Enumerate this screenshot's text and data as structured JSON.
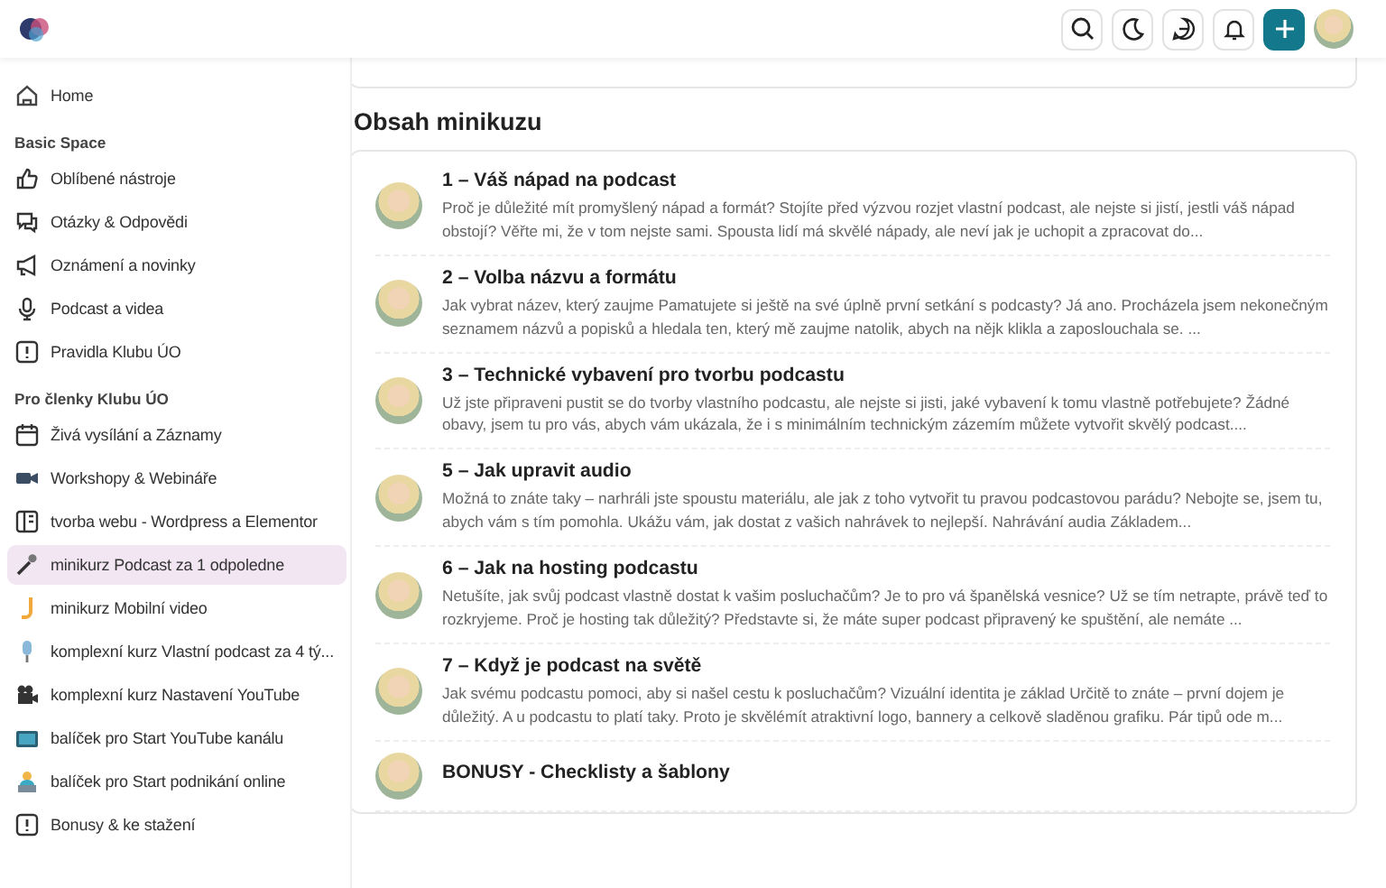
{
  "sidebar": {
    "home": {
      "label": "Home",
      "selected": false
    },
    "sections": [
      {
        "title": "Basic Space",
        "items": [
          {
            "label": "Oblíbené nástroje",
            "selected": false
          },
          {
            "label": "Otázky & Odpovědi",
            "selected": false
          },
          {
            "label": "Oznámení a novinky",
            "selected": false
          },
          {
            "label": "Podcast a videa",
            "selected": false
          },
          {
            "label": "Pravidla Klubu ÚO",
            "selected": false
          }
        ]
      },
      {
        "title": "Pro členky Klubu ÚO",
        "items": [
          {
            "label": "Živá vysílání a Záznamy",
            "selected": false
          },
          {
            "label": "Workshopy & Webináře",
            "selected": false
          },
          {
            "label": "tvorba webu - Wordpress a Elementor",
            "selected": false
          },
          {
            "label": "minikurz Podcast za 1 odpoledne",
            "selected": true
          },
          {
            "label": "minikurz Mobilní video",
            "selected": false
          },
          {
            "label": "komplexní kurz Vlastní podcast za 4 tý...",
            "selected": false
          },
          {
            "label": "komplexní kurz Nastavení YouTube",
            "selected": false
          },
          {
            "label": "balíček pro Start YouTube kanálu",
            "selected": false
          },
          {
            "label": "balíček pro Start podnikání online",
            "selected": false
          },
          {
            "label": "Bonusy & ke stažení",
            "selected": false
          }
        ]
      }
    ]
  },
  "main": {
    "heading": "Obsah minikuzu",
    "lessons": [
      {
        "title": "1 – Váš nápad na podcast",
        "text": "Proč je důležité mít promyšlený nápad a formát? Stojíte před výzvou rozjet vlastní podcast, ale nejste si jistí, jestli váš nápad obstojí? Věřte mi, že v tom nejste sami. Spousta lidí má skvělé nápady, ale neví jak je uchopit a zpracovat do..."
      },
      {
        "title": "2 – Volba názvu a formátu",
        "text": "Jak vybrat název, který zaujme Pamatujete si ještě na své úplně první setkání s podcasty? Já ano. Procházela jsem nekonečným seznamem názvů a popisků a hledala ten, který mě zaujme natolik, abych na nějk klikla a zaposlouchala se. ..."
      },
      {
        "title": "3 – Technické vybavení pro tvorbu podcastu",
        "text": "Už jste připraveni pustit se do tvorby vlastního podcastu, ale nejste si jisti, jaké vybavení k tomu vlastně potřebujete? Žádné obavy, jsem tu pro vás, abych vám ukázala, že i s minimálním technickým zázemím můžete vytvořit skvělý podcast...."
      },
      {
        "title": "5 – Jak upravit audio",
        "text": "Možná to znáte taky – narhráli jste spoustu materiálu, ale jak z toho vytvořit tu pravou podcastovou parádu? Nebojte se, jsem tu, abych vám s tím pomohla. Ukážu vám, jak dostat z vašich nahrávek to nejlepší. Nahrávání audia Základem..."
      },
      {
        "title": "6 – Jak na hosting podcastu",
        "text": "Netušíte, jak svůj podcast vlastně dostat k vašim posluchačům? Je to pro vá španělská vesnice? Už se tím netrapte, právě teď to rozkryjeme. Proč je hosting tak důležitý? Představte si, že máte super podcast připravený ke spuštění, ale nemáte ..."
      },
      {
        "title": "7 – Když je podcast na světě",
        "text": "Jak svému podcastu pomoci, aby si našel cestu k posluchačům? Vizuální identita je základ Určitě to znáte – první dojem je důležitý. A u podcastu to platí taky. Proto je skvělémít atraktivní logo, bannery a celkově sladěnou grafiku. Pár tipů ode m..."
      },
      {
        "title": "BONUSY - Checklisty a šablony"
      }
    ]
  }
}
